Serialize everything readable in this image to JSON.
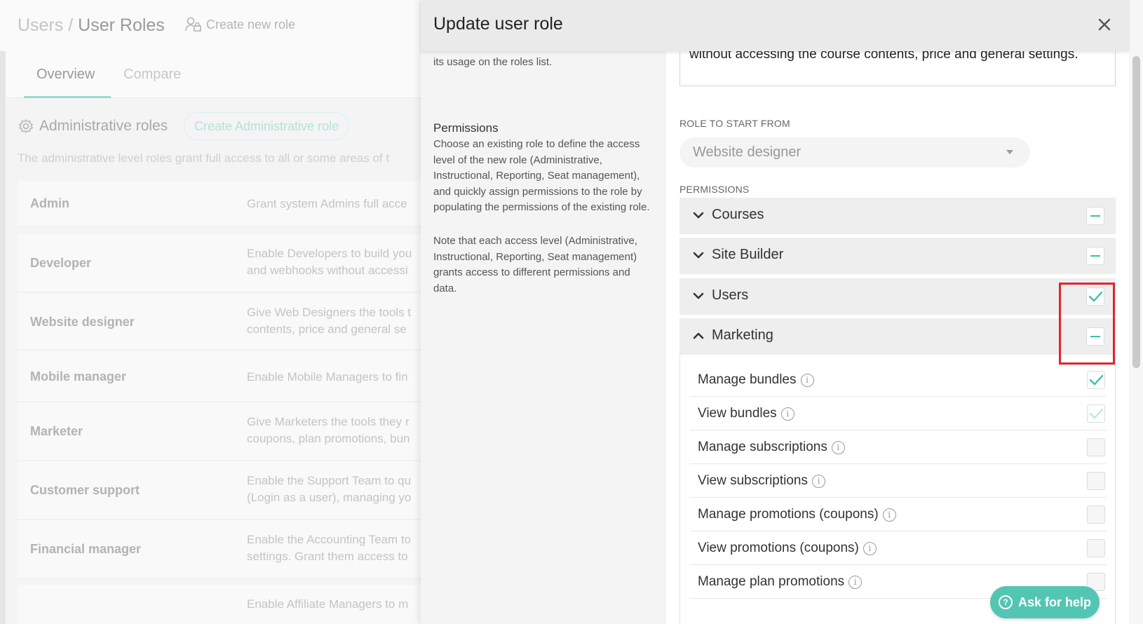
{
  "background": {
    "breadcrumb": {
      "parent": "Users",
      "separator": "/",
      "current": "User Roles"
    },
    "create_role_label": "Create new role",
    "tabs": [
      {
        "label": "Overview",
        "active": true
      },
      {
        "label": "Compare",
        "active": false
      }
    ],
    "section_title": "Administrative roles",
    "create_admin_label": "Create Administrative role",
    "section_desc": "The administrative level roles grant full access to all or some areas of t",
    "roles": [
      {
        "name": "Admin",
        "desc": [
          "Grant system Admins full acce"
        ]
      },
      {
        "name": "Developer",
        "desc": [
          "Enable Developers to build you",
          "and webhooks without accessi"
        ]
      },
      {
        "name": "Website designer",
        "desc": [
          "Give Web Designers the tools t",
          "contents, price and general se"
        ]
      },
      {
        "name": "Mobile manager",
        "desc": [
          "Enable Mobile Managers to fin"
        ]
      },
      {
        "name": "Marketer",
        "desc": [
          "Give Marketers the tools they r",
          "coupons, plan promotions, bun"
        ]
      },
      {
        "name": "Customer support",
        "desc": [
          "Enable the Support Team to qu",
          "(Login as a user), managing yo"
        ]
      },
      {
        "name": "Financial manager",
        "desc": [
          "Enable the Accounting Team to",
          "settings. Grant them access to"
        ]
      },
      {
        "name": "",
        "desc": [
          "Enable Affiliate Managers to m"
        ]
      }
    ]
  },
  "drawer": {
    "title": "Update user role",
    "close_label": "×",
    "left": {
      "usage_text": "its usage on the roles list.",
      "permissions_heading": "Permissions",
      "permissions_desc_1": "Choose an existing role to define the access level of the new role (Administrative, Instructional, Reporting, Seat management), and quickly assign permissions to the role by populating the permissions of the existing role.",
      "permissions_desc_2": "Note that each access level (Administrative, Instructional, Reporting, Seat management) grants access to different permissions and data."
    },
    "description_text": "without accessing the course contents, price and general settings.",
    "role_to_start_label": "ROLE TO START FROM",
    "role_to_start_value": "Website designer",
    "permissions_label": "PERMISSIONS",
    "groups": [
      {
        "label": "Courses",
        "expanded": false,
        "state": "partial"
      },
      {
        "label": "Site Builder",
        "expanded": false,
        "state": "partial"
      },
      {
        "label": "Users",
        "expanded": false,
        "state": "checked"
      },
      {
        "label": "Marketing",
        "expanded": true,
        "state": "partial"
      }
    ],
    "marketing_items": [
      {
        "label": "Manage bundles",
        "state": "checked"
      },
      {
        "label": "View bundles",
        "state": "checked-disabled"
      },
      {
        "label": "Manage subscriptions",
        "state": "unchecked"
      },
      {
        "label": "View subscriptions",
        "state": "unchecked"
      },
      {
        "label": "Manage promotions (coupons)",
        "state": "unchecked"
      },
      {
        "label": "View promotions (coupons)",
        "state": "unchecked"
      },
      {
        "label": "Manage plan promotions",
        "state": "unchecked"
      }
    ]
  },
  "help_button_label": "Ask for help",
  "colors": {
    "accent": "#3cbfab",
    "highlight": "#e3242b",
    "help": "#52c6b3"
  }
}
